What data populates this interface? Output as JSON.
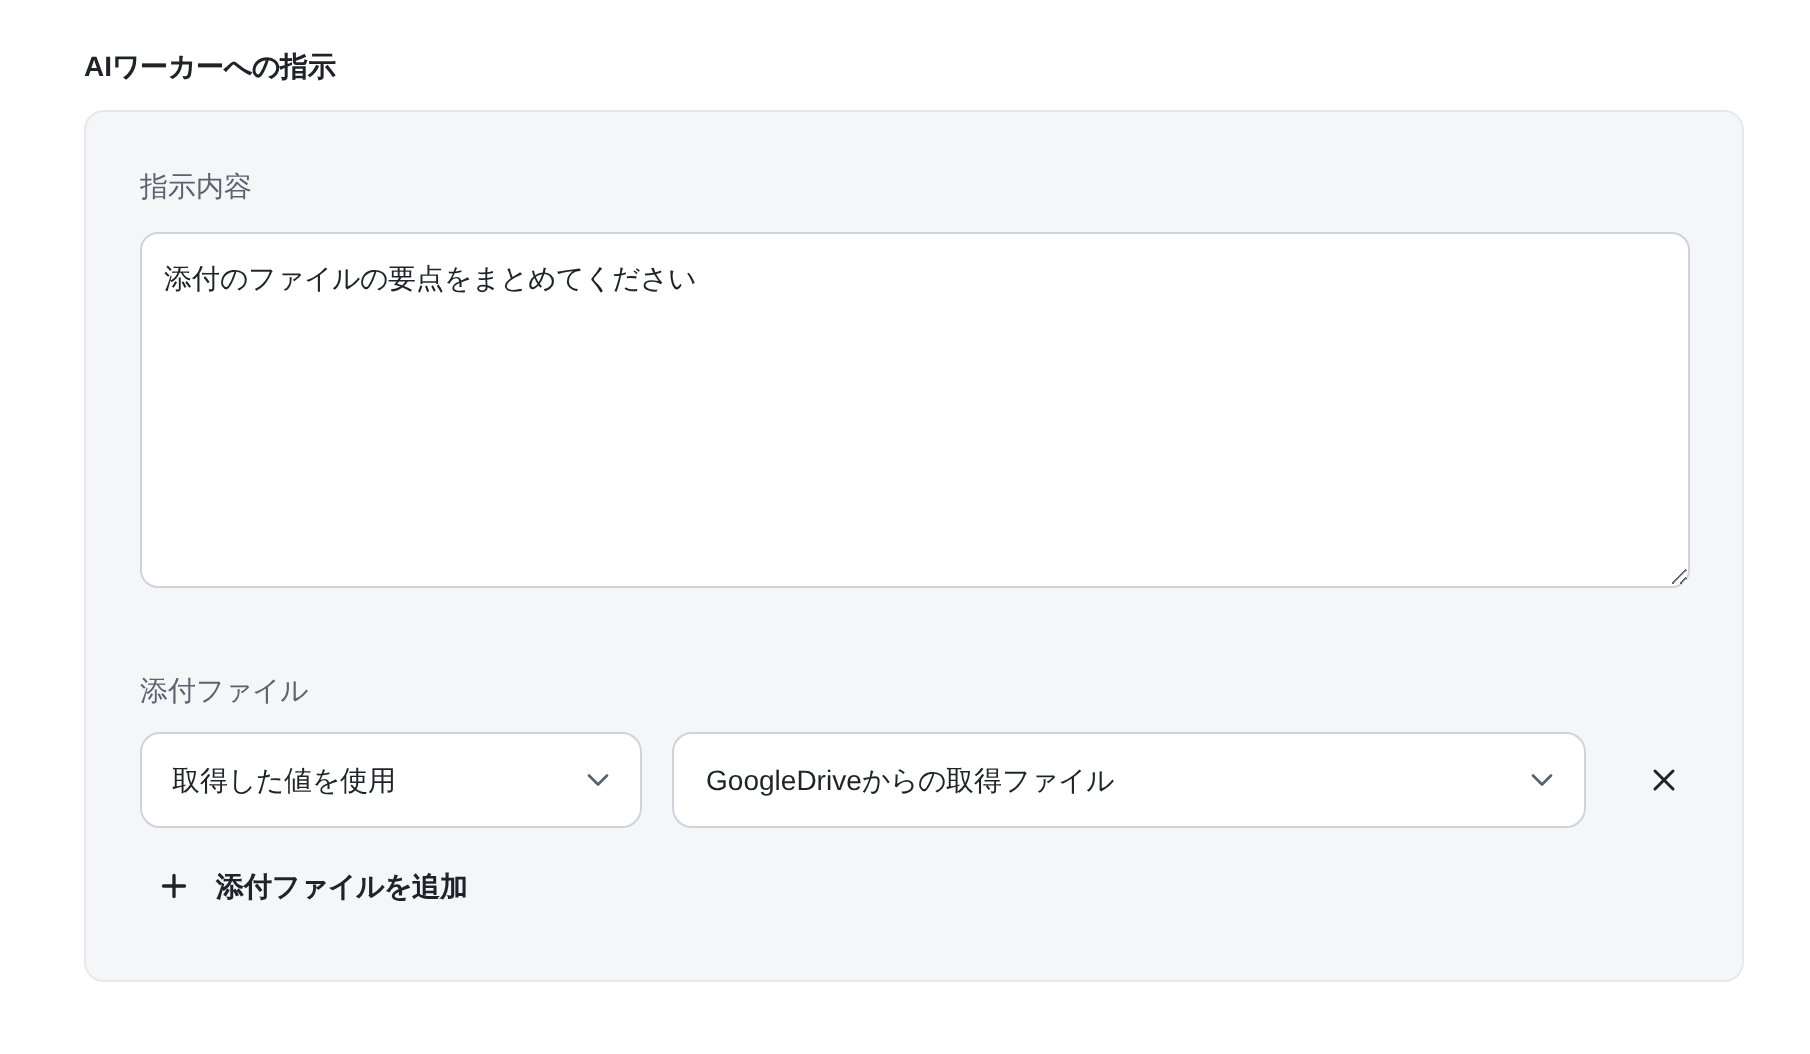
{
  "section_title": "AIワーカーへの指示",
  "instruction": {
    "label": "指示内容",
    "value": "添付のファイルの要点をまとめてください"
  },
  "attachments": {
    "label": "添付ファイル",
    "rows": [
      {
        "source": "取得した値を使用",
        "file": "GoogleDriveからの取得ファイル"
      }
    ],
    "add_button": "添付ファイルを追加"
  }
}
